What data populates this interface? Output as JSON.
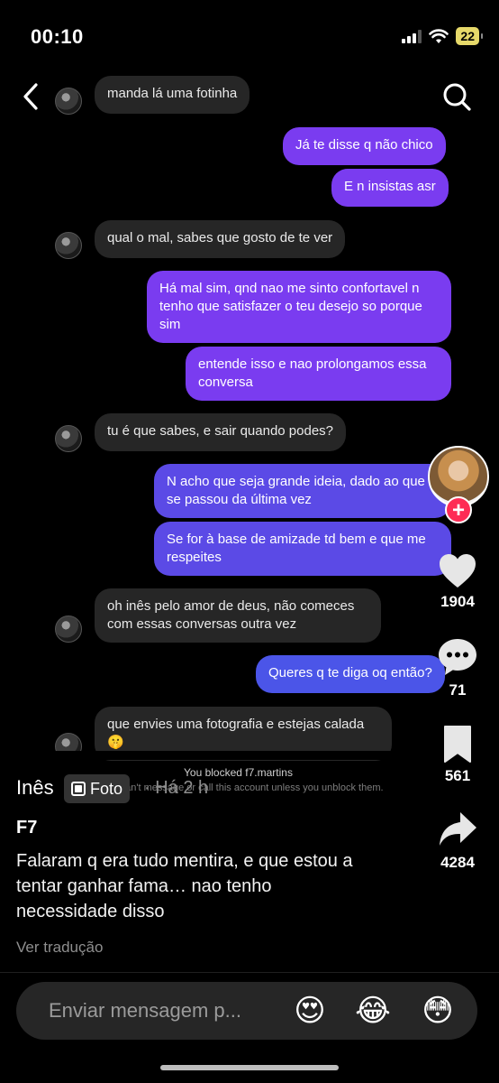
{
  "status_bar": {
    "time": "00:10",
    "battery": "22"
  },
  "chat": {
    "messages": [
      {
        "side": "recv",
        "text": "manda lá uma fotinha"
      },
      {
        "side": "sent",
        "text": "Já te disse q não chico"
      },
      {
        "side": "sent",
        "text": "E n insistas asr"
      },
      {
        "side": "recv",
        "text": "qual o mal, sabes que gosto de te ver"
      },
      {
        "side": "sent",
        "text": "Há mal sim, qnd nao me sinto confortavel n tenho que satisfazer o teu desejo so porque sim"
      },
      {
        "side": "sent",
        "text": "entende isso e nao prolongamos essa conversa"
      },
      {
        "side": "recv",
        "text": "tu é que sabes, e sair quando podes?"
      },
      {
        "side": "sent",
        "text": "N acho que seja grande ideia, dado ao que se passou da última vez"
      },
      {
        "side": "sent",
        "text": "Se for à base de amizade td bem e que me respeites"
      },
      {
        "side": "recv",
        "text": "oh inês pelo amor de deus, não comeces com essas conversas outra vez"
      },
      {
        "side": "sent",
        "text": "Queres q te diga oq então?"
      },
      {
        "side": "recv",
        "text": "que envies uma fotografia e estejas calada 🤫"
      }
    ],
    "blocked_title": "You blocked f7.martins",
    "blocked_subtitle": "You can't message or call this account unless you unblock them."
  },
  "rail": {
    "likes": "1904",
    "comments": "71",
    "saves": "561",
    "shares": "4284",
    "follow_symbol": "+",
    "icons": [
      "heart-icon",
      "comment-icon",
      "bookmark-icon",
      "share-icon"
    ]
  },
  "post": {
    "author": "Inês",
    "type_badge": "Foto",
    "time": "· Há 2 h",
    "title": "F7",
    "caption": "Falaram q era tudo mentira, e que estou a tentar ganhar fama… nao tenho necessidade disso",
    "translate_label": "Ver tradução"
  },
  "composer": {
    "placeholder": "Enviar mensagem p...",
    "emojis": [
      "😍",
      "😂",
      "😳"
    ]
  },
  "colors": {
    "sent_purple": "#7a3cf0",
    "sent_indigo": "#5b4ae6",
    "sent_blue": "#4b55e8",
    "received": "#262626",
    "follow_red": "#fe2c55"
  }
}
